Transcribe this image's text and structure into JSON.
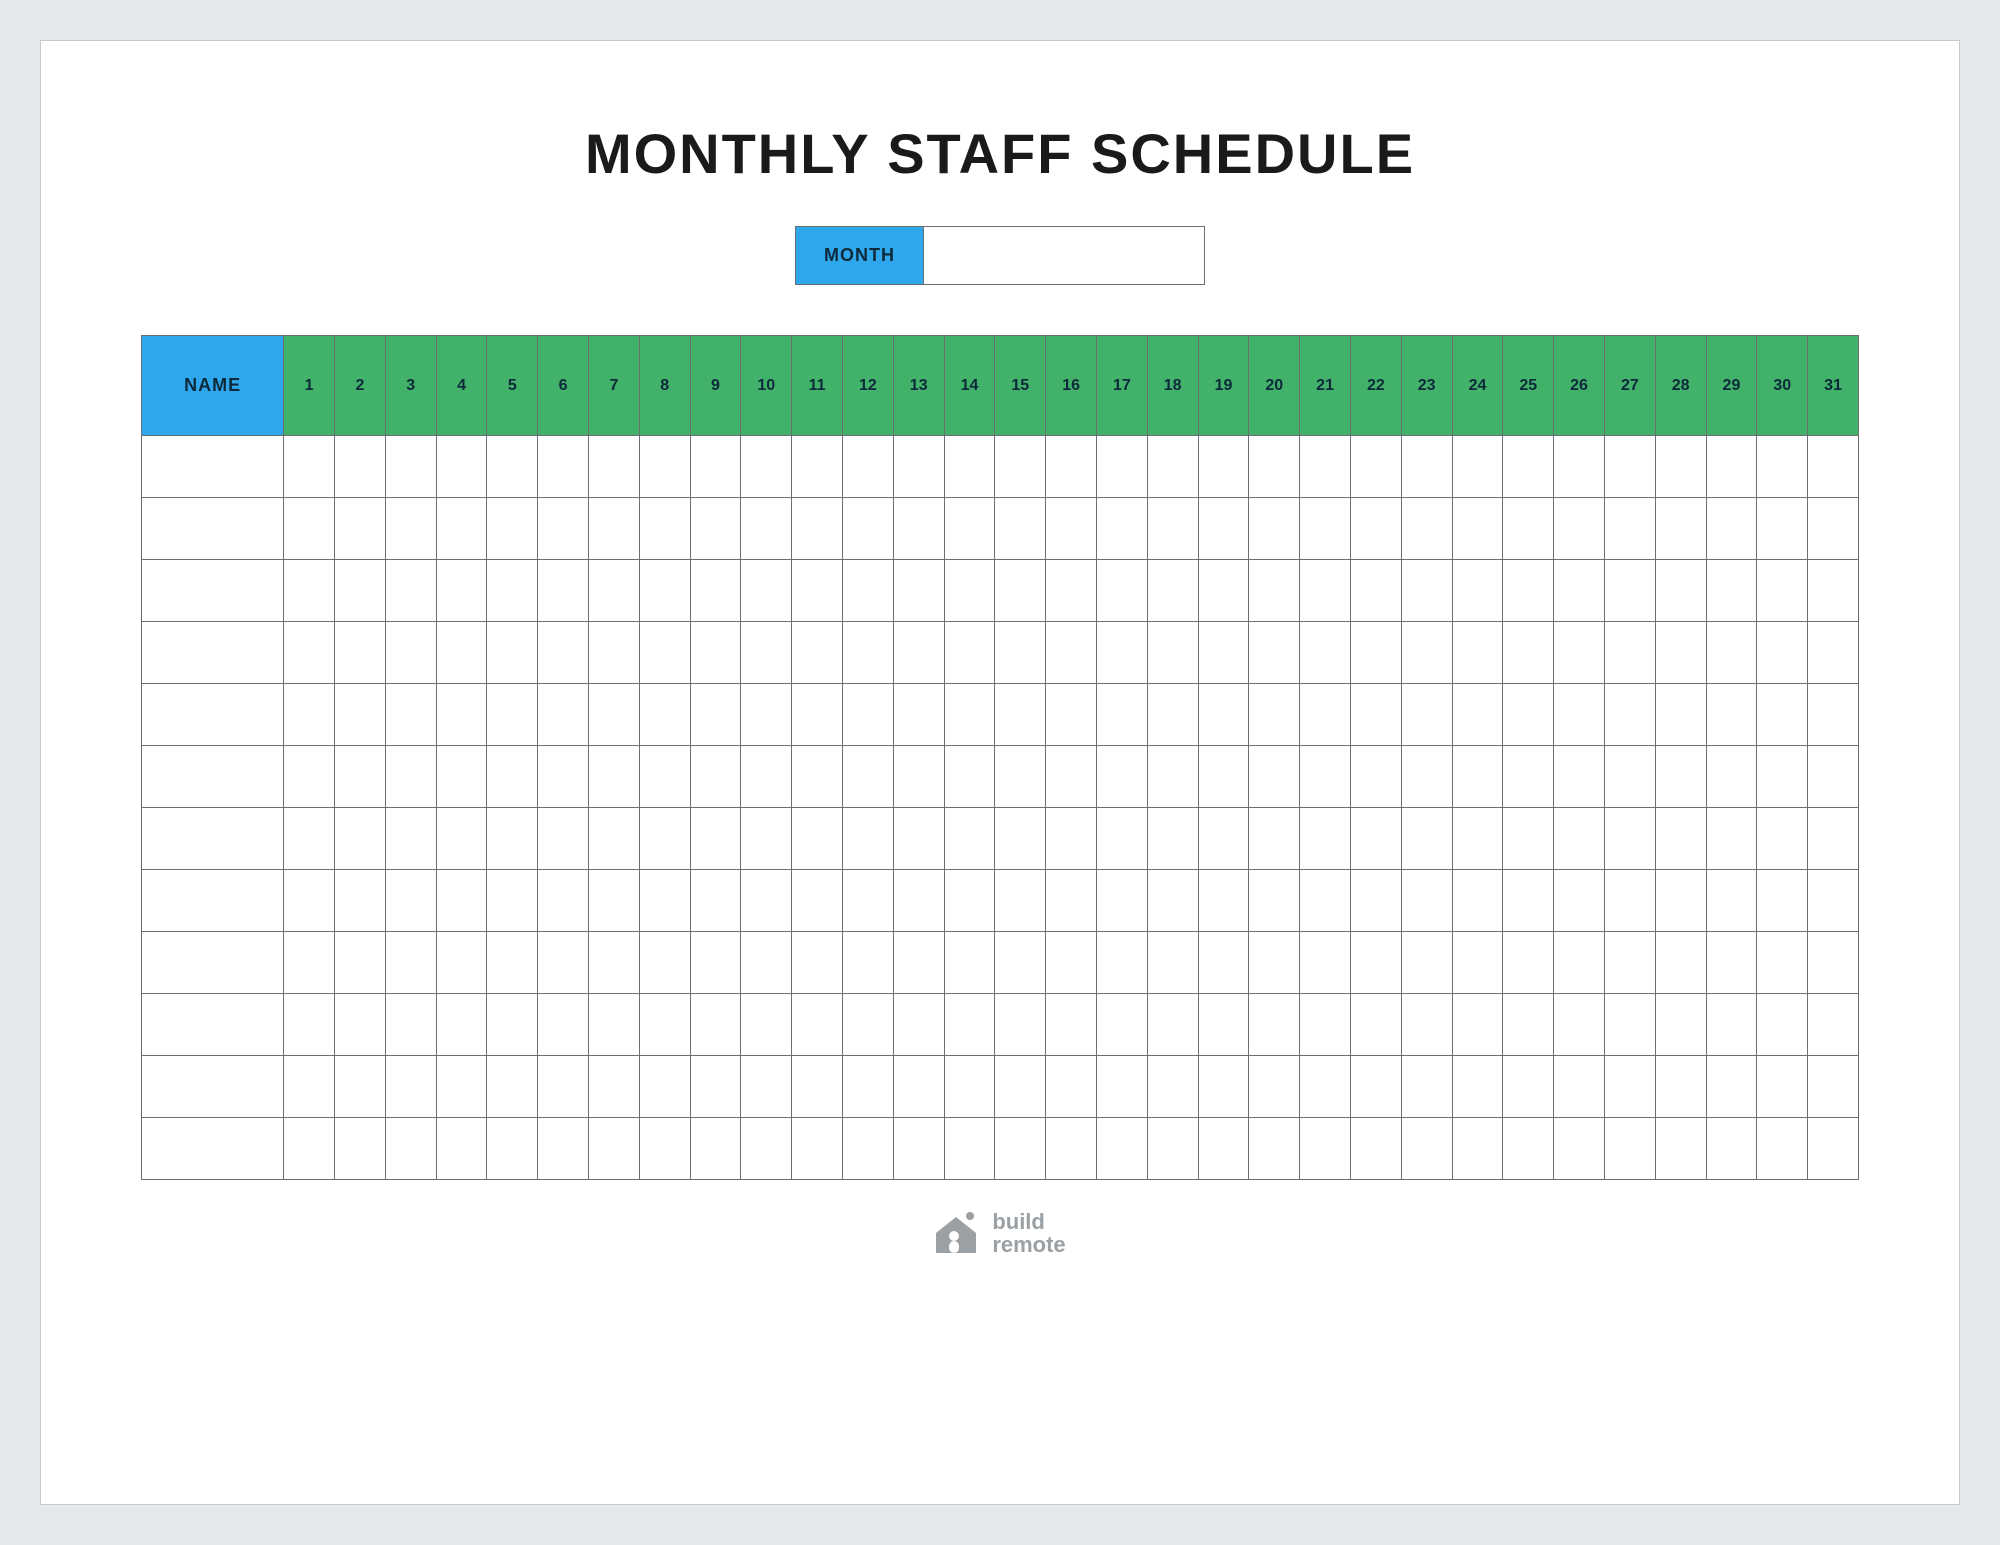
{
  "title": "MONTHLY STAFF SCHEDULE",
  "month_label": "MONTH",
  "month_value": "",
  "table": {
    "name_header": "NAME",
    "days": [
      "1",
      "2",
      "3",
      "4",
      "5",
      "6",
      "7",
      "8",
      "9",
      "10",
      "11",
      "12",
      "13",
      "14",
      "15",
      "16",
      "17",
      "18",
      "19",
      "20",
      "21",
      "22",
      "23",
      "24",
      "25",
      "26",
      "27",
      "28",
      "29",
      "30",
      "31"
    ],
    "row_count": 12
  },
  "footer": {
    "brand_line1": "build",
    "brand_line2": "remote"
  },
  "colors": {
    "page_bg": "#e5e8ea",
    "blue": "#2ea7ed",
    "green": "#42b16a",
    "grid": "#6b6f72",
    "logo": "#9aa0a4"
  }
}
